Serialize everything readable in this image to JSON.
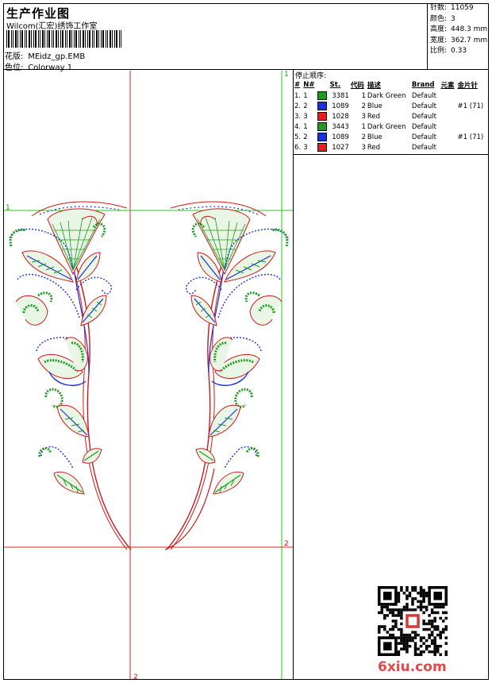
{
  "header": {
    "title": "生产作业图",
    "company": "Wilcom(汇宏)绣饰工作室",
    "design_label": "花版:",
    "design_value": "MEidz_gp.EMB",
    "colorway_label": "色位:",
    "colorway_value": "Colorway 1"
  },
  "info": [
    {
      "label": "针数:",
      "value": "11059"
    },
    {
      "label": "颜色:",
      "value": "3"
    },
    {
      "label": "高度:",
      "value": "448.3 mm"
    },
    {
      "label": "宽度:",
      "value": "362.7 mm"
    },
    {
      "label": "比例:",
      "value": "0.33"
    }
  ],
  "guides": {
    "v1": "1",
    "v2": "2",
    "h1": "1",
    "h2": "2"
  },
  "stop_sequence": {
    "title": "停止顺序:",
    "headers": [
      "#",
      "N#",
      "St.",
      "代码",
      "描述",
      "Brand",
      "元素",
      "金片针"
    ],
    "rows": [
      {
        "num": "1.",
        "n": "1",
        "color": "#1e9a1e",
        "st": "3381",
        "code": "1",
        "desc": "Dark Green",
        "brand": "Default",
        "elem": "",
        "seq": ""
      },
      {
        "num": "2.",
        "n": "2",
        "color": "#1c2fe0",
        "st": "1089",
        "code": "2",
        "desc": "Blue",
        "brand": "Default",
        "elem": "",
        "seq": "#1 (71)"
      },
      {
        "num": "3.",
        "n": "3",
        "color": "#e41e1e",
        "st": "1028",
        "code": "3",
        "desc": "Red",
        "brand": "Default",
        "elem": "",
        "seq": ""
      },
      {
        "num": "4.",
        "n": "1",
        "color": "#1e9a1e",
        "st": "3443",
        "code": "1",
        "desc": "Dark Green",
        "brand": "Default",
        "elem": "",
        "seq": ""
      },
      {
        "num": "5.",
        "n": "2",
        "color": "#1c2fe0",
        "st": "1089",
        "code": "2",
        "desc": "Blue",
        "brand": "Default",
        "elem": "",
        "seq": "#1 (71)"
      },
      {
        "num": "6.",
        "n": "3",
        "color": "#e41e1e",
        "st": "1027",
        "code": "3",
        "desc": "Red",
        "brand": "Default",
        "elem": "",
        "seq": ""
      }
    ]
  },
  "watermark": "6xiu.com"
}
